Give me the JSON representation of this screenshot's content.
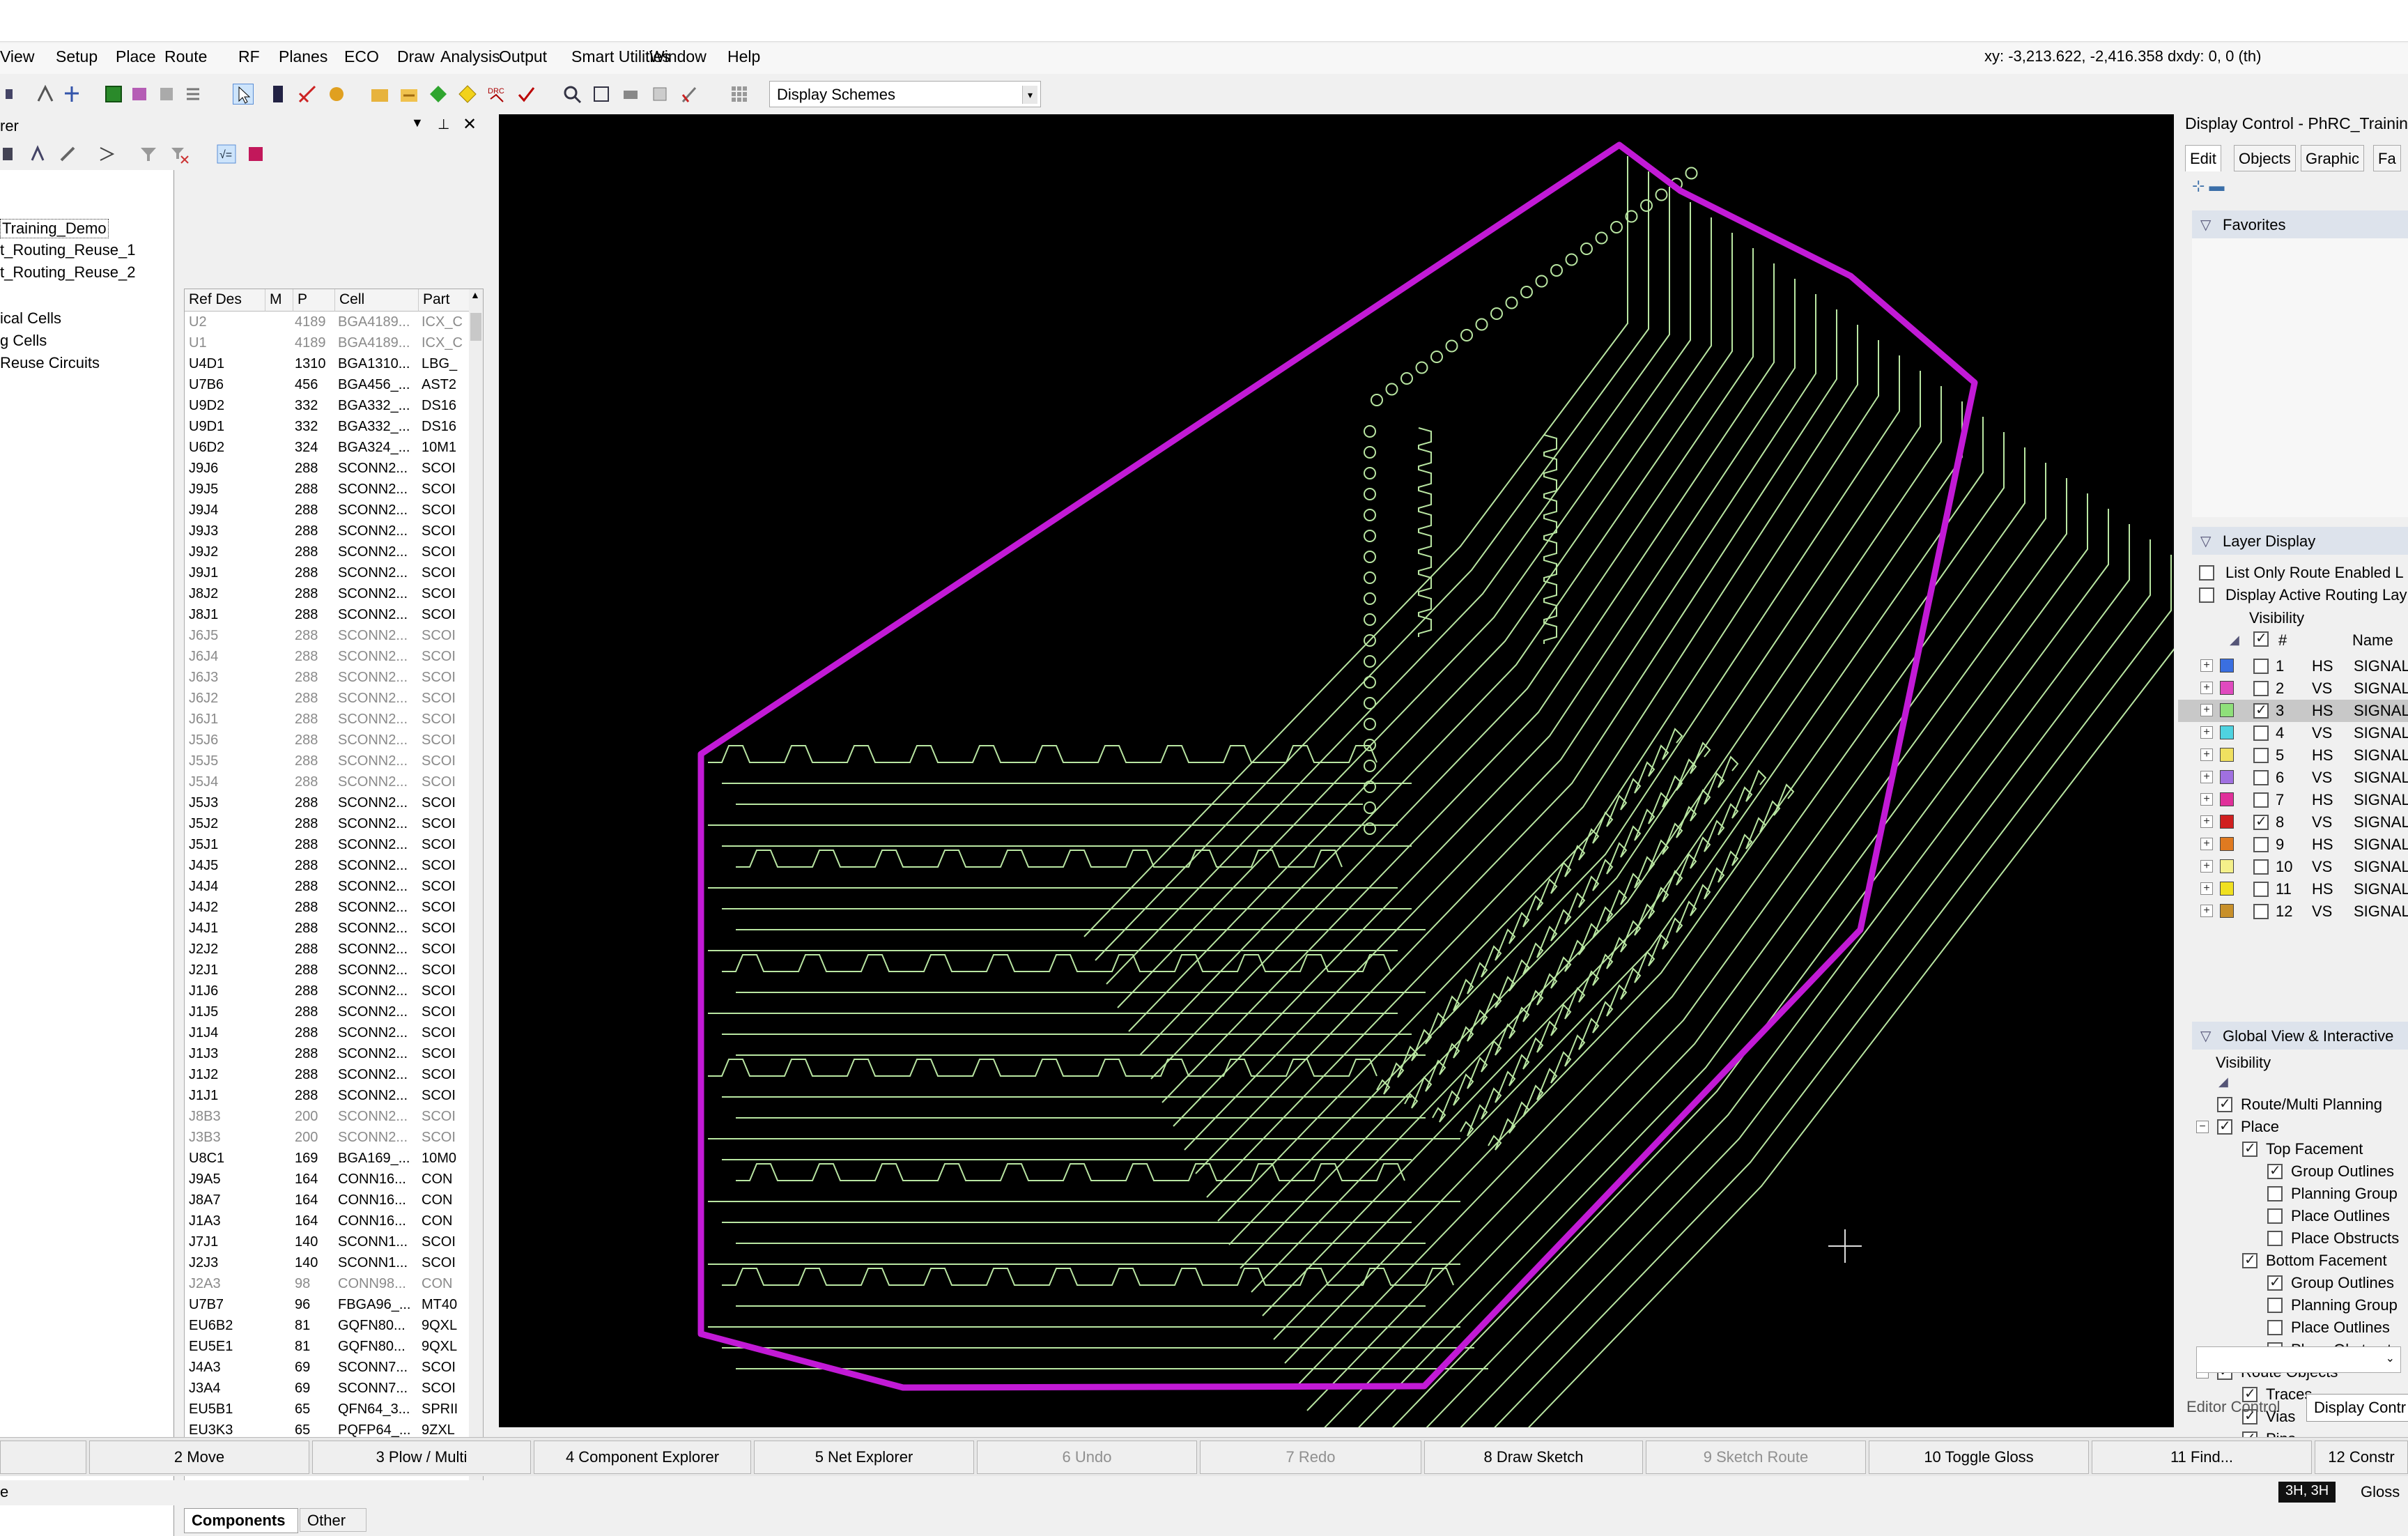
{
  "menu": [
    "View",
    "Setup",
    "Place",
    "Route",
    "RF",
    "Planes",
    "ECO",
    "Draw",
    "Analysis",
    "Output",
    "Smart Utilities",
    "Window",
    "Help"
  ],
  "coordinates": "xy: -3,213.622, -2,416.358  dxdy: 0, 0  (th)",
  "toolbar": {
    "display_scheme": "Display Schemes"
  },
  "left_panel": {
    "title_fragment": "rer",
    "tree": [
      {
        "label": "Training_Demo",
        "selected": true
      },
      {
        "label": "t_Routing_Reuse_1"
      },
      {
        "label": "t_Routing_Reuse_2"
      },
      {
        "label": "ical Cells"
      },
      {
        "label": "g Cells"
      },
      {
        "label": "Reuse Circuits"
      }
    ],
    "columns": [
      "Ref Des",
      "M",
      "P",
      "Cell",
      "Part"
    ],
    "rows": [
      {
        "ref": "U2",
        "p": "4189",
        "cell": "BGA4189...",
        "part": "ICX_C",
        "dim": true
      },
      {
        "ref": "U1",
        "p": "4189",
        "cell": "BGA4189...",
        "part": "ICX_C",
        "dim": true
      },
      {
        "ref": "U4D1",
        "p": "1310",
        "cell": "BGA1310...",
        "part": "LBG_"
      },
      {
        "ref": "U7B6",
        "p": "456",
        "cell": "BGA456_...",
        "part": "AST2"
      },
      {
        "ref": "U9D2",
        "p": "332",
        "cell": "BGA332_...",
        "part": "DS16"
      },
      {
        "ref": "U9D1",
        "p": "332",
        "cell": "BGA332_...",
        "part": "DS16"
      },
      {
        "ref": "U6D2",
        "p": "324",
        "cell": "BGA324_...",
        "part": "10M1"
      },
      {
        "ref": "J9J6",
        "p": "288",
        "cell": "SCONN2...",
        "part": "SCOI"
      },
      {
        "ref": "J9J5",
        "p": "288",
        "cell": "SCONN2...",
        "part": "SCOI"
      },
      {
        "ref": "J9J4",
        "p": "288",
        "cell": "SCONN2...",
        "part": "SCOI"
      },
      {
        "ref": "J9J3",
        "p": "288",
        "cell": "SCONN2...",
        "part": "SCOI"
      },
      {
        "ref": "J9J2",
        "p": "288",
        "cell": "SCONN2...",
        "part": "SCOI"
      },
      {
        "ref": "J9J1",
        "p": "288",
        "cell": "SCONN2...",
        "part": "SCOI"
      },
      {
        "ref": "J8J2",
        "p": "288",
        "cell": "SCONN2...",
        "part": "SCOI"
      },
      {
        "ref": "J8J1",
        "p": "288",
        "cell": "SCONN2...",
        "part": "SCOI"
      },
      {
        "ref": "J6J5",
        "p": "288",
        "cell": "SCONN2...",
        "part": "SCOI",
        "dim": true
      },
      {
        "ref": "J6J4",
        "p": "288",
        "cell": "SCONN2...",
        "part": "SCOI",
        "dim": true
      },
      {
        "ref": "J6J3",
        "p": "288",
        "cell": "SCONN2...",
        "part": "SCOI",
        "dim": true
      },
      {
        "ref": "J6J2",
        "p": "288",
        "cell": "SCONN2...",
        "part": "SCOI",
        "dim": true
      },
      {
        "ref": "J6J1",
        "p": "288",
        "cell": "SCONN2...",
        "part": "SCOI",
        "dim": true
      },
      {
        "ref": "J5J6",
        "p": "288",
        "cell": "SCONN2...",
        "part": "SCOI",
        "dim": true
      },
      {
        "ref": "J5J5",
        "p": "288",
        "cell": "SCONN2...",
        "part": "SCOI",
        "dim": true
      },
      {
        "ref": "J5J4",
        "p": "288",
        "cell": "SCONN2...",
        "part": "SCOI",
        "dim": true
      },
      {
        "ref": "J5J3",
        "p": "288",
        "cell": "SCONN2...",
        "part": "SCOI"
      },
      {
        "ref": "J5J2",
        "p": "288",
        "cell": "SCONN2...",
        "part": "SCOI"
      },
      {
        "ref": "J5J1",
        "p": "288",
        "cell": "SCONN2...",
        "part": "SCOI"
      },
      {
        "ref": "J4J5",
        "p": "288",
        "cell": "SCONN2...",
        "part": "SCOI"
      },
      {
        "ref": "J4J4",
        "p": "288",
        "cell": "SCONN2...",
        "part": "SCOI"
      },
      {
        "ref": "J4J2",
        "p": "288",
        "cell": "SCONN2...",
        "part": "SCOI"
      },
      {
        "ref": "J4J1",
        "p": "288",
        "cell": "SCONN2...",
        "part": "SCOI"
      },
      {
        "ref": "J2J2",
        "p": "288",
        "cell": "SCONN2...",
        "part": "SCOI"
      },
      {
        "ref": "J2J1",
        "p": "288",
        "cell": "SCONN2...",
        "part": "SCOI"
      },
      {
        "ref": "J1J6",
        "p": "288",
        "cell": "SCONN2...",
        "part": "SCOI"
      },
      {
        "ref": "J1J5",
        "p": "288",
        "cell": "SCONN2...",
        "part": "SCOI"
      },
      {
        "ref": "J1J4",
        "p": "288",
        "cell": "SCONN2...",
        "part": "SCOI"
      },
      {
        "ref": "J1J3",
        "p": "288",
        "cell": "SCONN2...",
        "part": "SCOI"
      },
      {
        "ref": "J1J2",
        "p": "288",
        "cell": "SCONN2...",
        "part": "SCOI"
      },
      {
        "ref": "J1J1",
        "p": "288",
        "cell": "SCONN2...",
        "part": "SCOI"
      },
      {
        "ref": "J8B3",
        "p": "200",
        "cell": "SCONN2...",
        "part": "SCOI",
        "dim": true
      },
      {
        "ref": "J3B3",
        "p": "200",
        "cell": "SCONN2...",
        "part": "SCOI",
        "dim": true
      },
      {
        "ref": "U8C1",
        "p": "169",
        "cell": "BGA169_...",
        "part": "10M0"
      },
      {
        "ref": "J9A5",
        "p": "164",
        "cell": "CONN16...",
        "part": "CON"
      },
      {
        "ref": "J8A7",
        "p": "164",
        "cell": "CONN16...",
        "part": "CON"
      },
      {
        "ref": "J1A3",
        "p": "164",
        "cell": "CONN16...",
        "part": "CON"
      },
      {
        "ref": "J7J1",
        "p": "140",
        "cell": "SCONN1...",
        "part": "SCOI"
      },
      {
        "ref": "J2J3",
        "p": "140",
        "cell": "SCONN1...",
        "part": "SCOI"
      },
      {
        "ref": "J2A3",
        "p": "98",
        "cell": "CONN98...",
        "part": "CON",
        "dim": true
      },
      {
        "ref": "U7B7",
        "p": "96",
        "cell": "FBGA96_...",
        "part": "MT40"
      },
      {
        "ref": "EU6B2",
        "p": "81",
        "cell": "GQFN80...",
        "part": "9QXL"
      },
      {
        "ref": "EU5E1",
        "p": "81",
        "cell": "GQFN80...",
        "part": "9QXL"
      },
      {
        "ref": "J4A3",
        "p": "69",
        "cell": "SCONN7...",
        "part": "SCOI"
      },
      {
        "ref": "J3A4",
        "p": "69",
        "cell": "SCONN7...",
        "part": "SCOI"
      },
      {
        "ref": "EU5B1",
        "p": "65",
        "cell": "QFN64_3...",
        "part": "SPRII"
      },
      {
        "ref": "EU3K3",
        "p": "65",
        "cell": "PQFP64_...",
        "part": "9ZXL"
      }
    ],
    "tabs": [
      "Components",
      "Other"
    ]
  },
  "right_panel": {
    "title": "Display Control - PhRC_Training",
    "tabs": [
      "Edit",
      "Objects",
      "Graphic",
      "Fa"
    ],
    "favorites": "Favorites",
    "layer_display": "Layer Display",
    "options": [
      "List Only Route Enabled L",
      "Display Active Routing Lay"
    ],
    "visibility": "Visibility",
    "layer_header": {
      "num": "#",
      "name": "Name"
    },
    "layers": [
      {
        "num": "1",
        "dir": "HS",
        "name": "SIGNAL_",
        "color": "#3a6fe0",
        "checked": false
      },
      {
        "num": "2",
        "dir": "VS",
        "name": "SIGNAL_",
        "color": "#e04bbf",
        "checked": false
      },
      {
        "num": "3",
        "dir": "HS",
        "name": "SIGNAL_",
        "color": "#8fe07a",
        "checked": true,
        "highlight": true
      },
      {
        "num": "4",
        "dir": "VS",
        "name": "SIGNAL_",
        "color": "#4fd3e0",
        "checked": false
      },
      {
        "num": "5",
        "dir": "HS",
        "name": "SIGNAL_",
        "color": "#f0e060",
        "checked": false
      },
      {
        "num": "6",
        "dir": "VS",
        "name": "SIGNAL_",
        "color": "#a070e0",
        "checked": false
      },
      {
        "num": "7",
        "dir": "HS",
        "name": "SIGNAL_",
        "color": "#e0309a",
        "checked": false
      },
      {
        "num": "8",
        "dir": "VS",
        "name": "SIGNAL_",
        "color": "#d02020",
        "checked": true
      },
      {
        "num": "9",
        "dir": "HS",
        "name": "SIGNAL_",
        "color": "#e07a20",
        "checked": false
      },
      {
        "num": "10",
        "dir": "VS",
        "name": "SIGNAL_",
        "color": "#f4f08a",
        "checked": false
      },
      {
        "num": "11",
        "dir": "HS",
        "name": "SIGNAL_",
        "color": "#f0e020",
        "checked": false
      },
      {
        "num": "12",
        "dir": "VS",
        "name": "SIGNAL_",
        "color": "#c8902a",
        "checked": false
      }
    ],
    "global_view": "Global View & Interactive",
    "global_visibility": "Visibility",
    "global_items": [
      {
        "label": "Route/Multi Planning",
        "indent": 0,
        "checked": true,
        "expander": ""
      },
      {
        "label": "Place",
        "indent": 0,
        "checked": true,
        "expander": "−"
      },
      {
        "label": "Top Facement",
        "indent": 1,
        "checked": true,
        "expander": ""
      },
      {
        "label": "Group Outlines",
        "indent": 2,
        "checked": true,
        "expander": ""
      },
      {
        "label": "Planning Group",
        "indent": 2,
        "checked": false,
        "expander": ""
      },
      {
        "label": "Place Outlines",
        "indent": 2,
        "checked": false,
        "expander": ""
      },
      {
        "label": "Place Obstructs",
        "indent": 2,
        "checked": false,
        "expander": ""
      },
      {
        "label": "Bottom Facement",
        "indent": 1,
        "checked": true,
        "expander": ""
      },
      {
        "label": "Group Outlines",
        "indent": 2,
        "checked": true,
        "expander": ""
      },
      {
        "label": "Planning Group",
        "indent": 2,
        "checked": false,
        "expander": ""
      },
      {
        "label": "Place Outlines",
        "indent": 2,
        "checked": false,
        "expander": ""
      },
      {
        "label": "Place Obstructs",
        "indent": 2,
        "checked": false,
        "expander": ""
      },
      {
        "label": "Route Objects",
        "indent": 0,
        "checked": true,
        "expander": "−"
      },
      {
        "label": "Traces",
        "indent": 1,
        "checked": true,
        "expander": ""
      },
      {
        "label": "Vias",
        "indent": 1,
        "checked": true,
        "expander": ""
      },
      {
        "label": "Pins",
        "indent": 1,
        "checked": true,
        "expander": ""
      }
    ],
    "bottom_tabs": [
      "Editor Control",
      "Display Contr"
    ]
  },
  "function_keys": [
    {
      "label": "",
      "disabled": false
    },
    {
      "label": "2 Move",
      "disabled": false
    },
    {
      "label": "3 Plow / Multi",
      "disabled": false
    },
    {
      "label": "4 Component Explorer",
      "disabled": false
    },
    {
      "label": "5 Net Explorer",
      "disabled": false
    },
    {
      "label": "6 Undo",
      "disabled": true
    },
    {
      "label": "7 Redo",
      "disabled": true
    },
    {
      "label": "8 Draw Sketch",
      "disabled": false
    },
    {
      "label": "9 Sketch Route",
      "disabled": true
    },
    {
      "label": "10 Toggle Gloss",
      "disabled": false
    },
    {
      "label": "11 Find...",
      "disabled": false
    },
    {
      "label": "12 Constr",
      "disabled": false
    }
  ],
  "status": {
    "left": "e",
    "layer": "3H, 3H",
    "gloss": "Gloss"
  },
  "colors": {
    "board_outline": "#c21ad6",
    "traces": "#b9e6a2",
    "canvas_bg": "#000000",
    "layer_highlight": "#c8c8c8"
  }
}
